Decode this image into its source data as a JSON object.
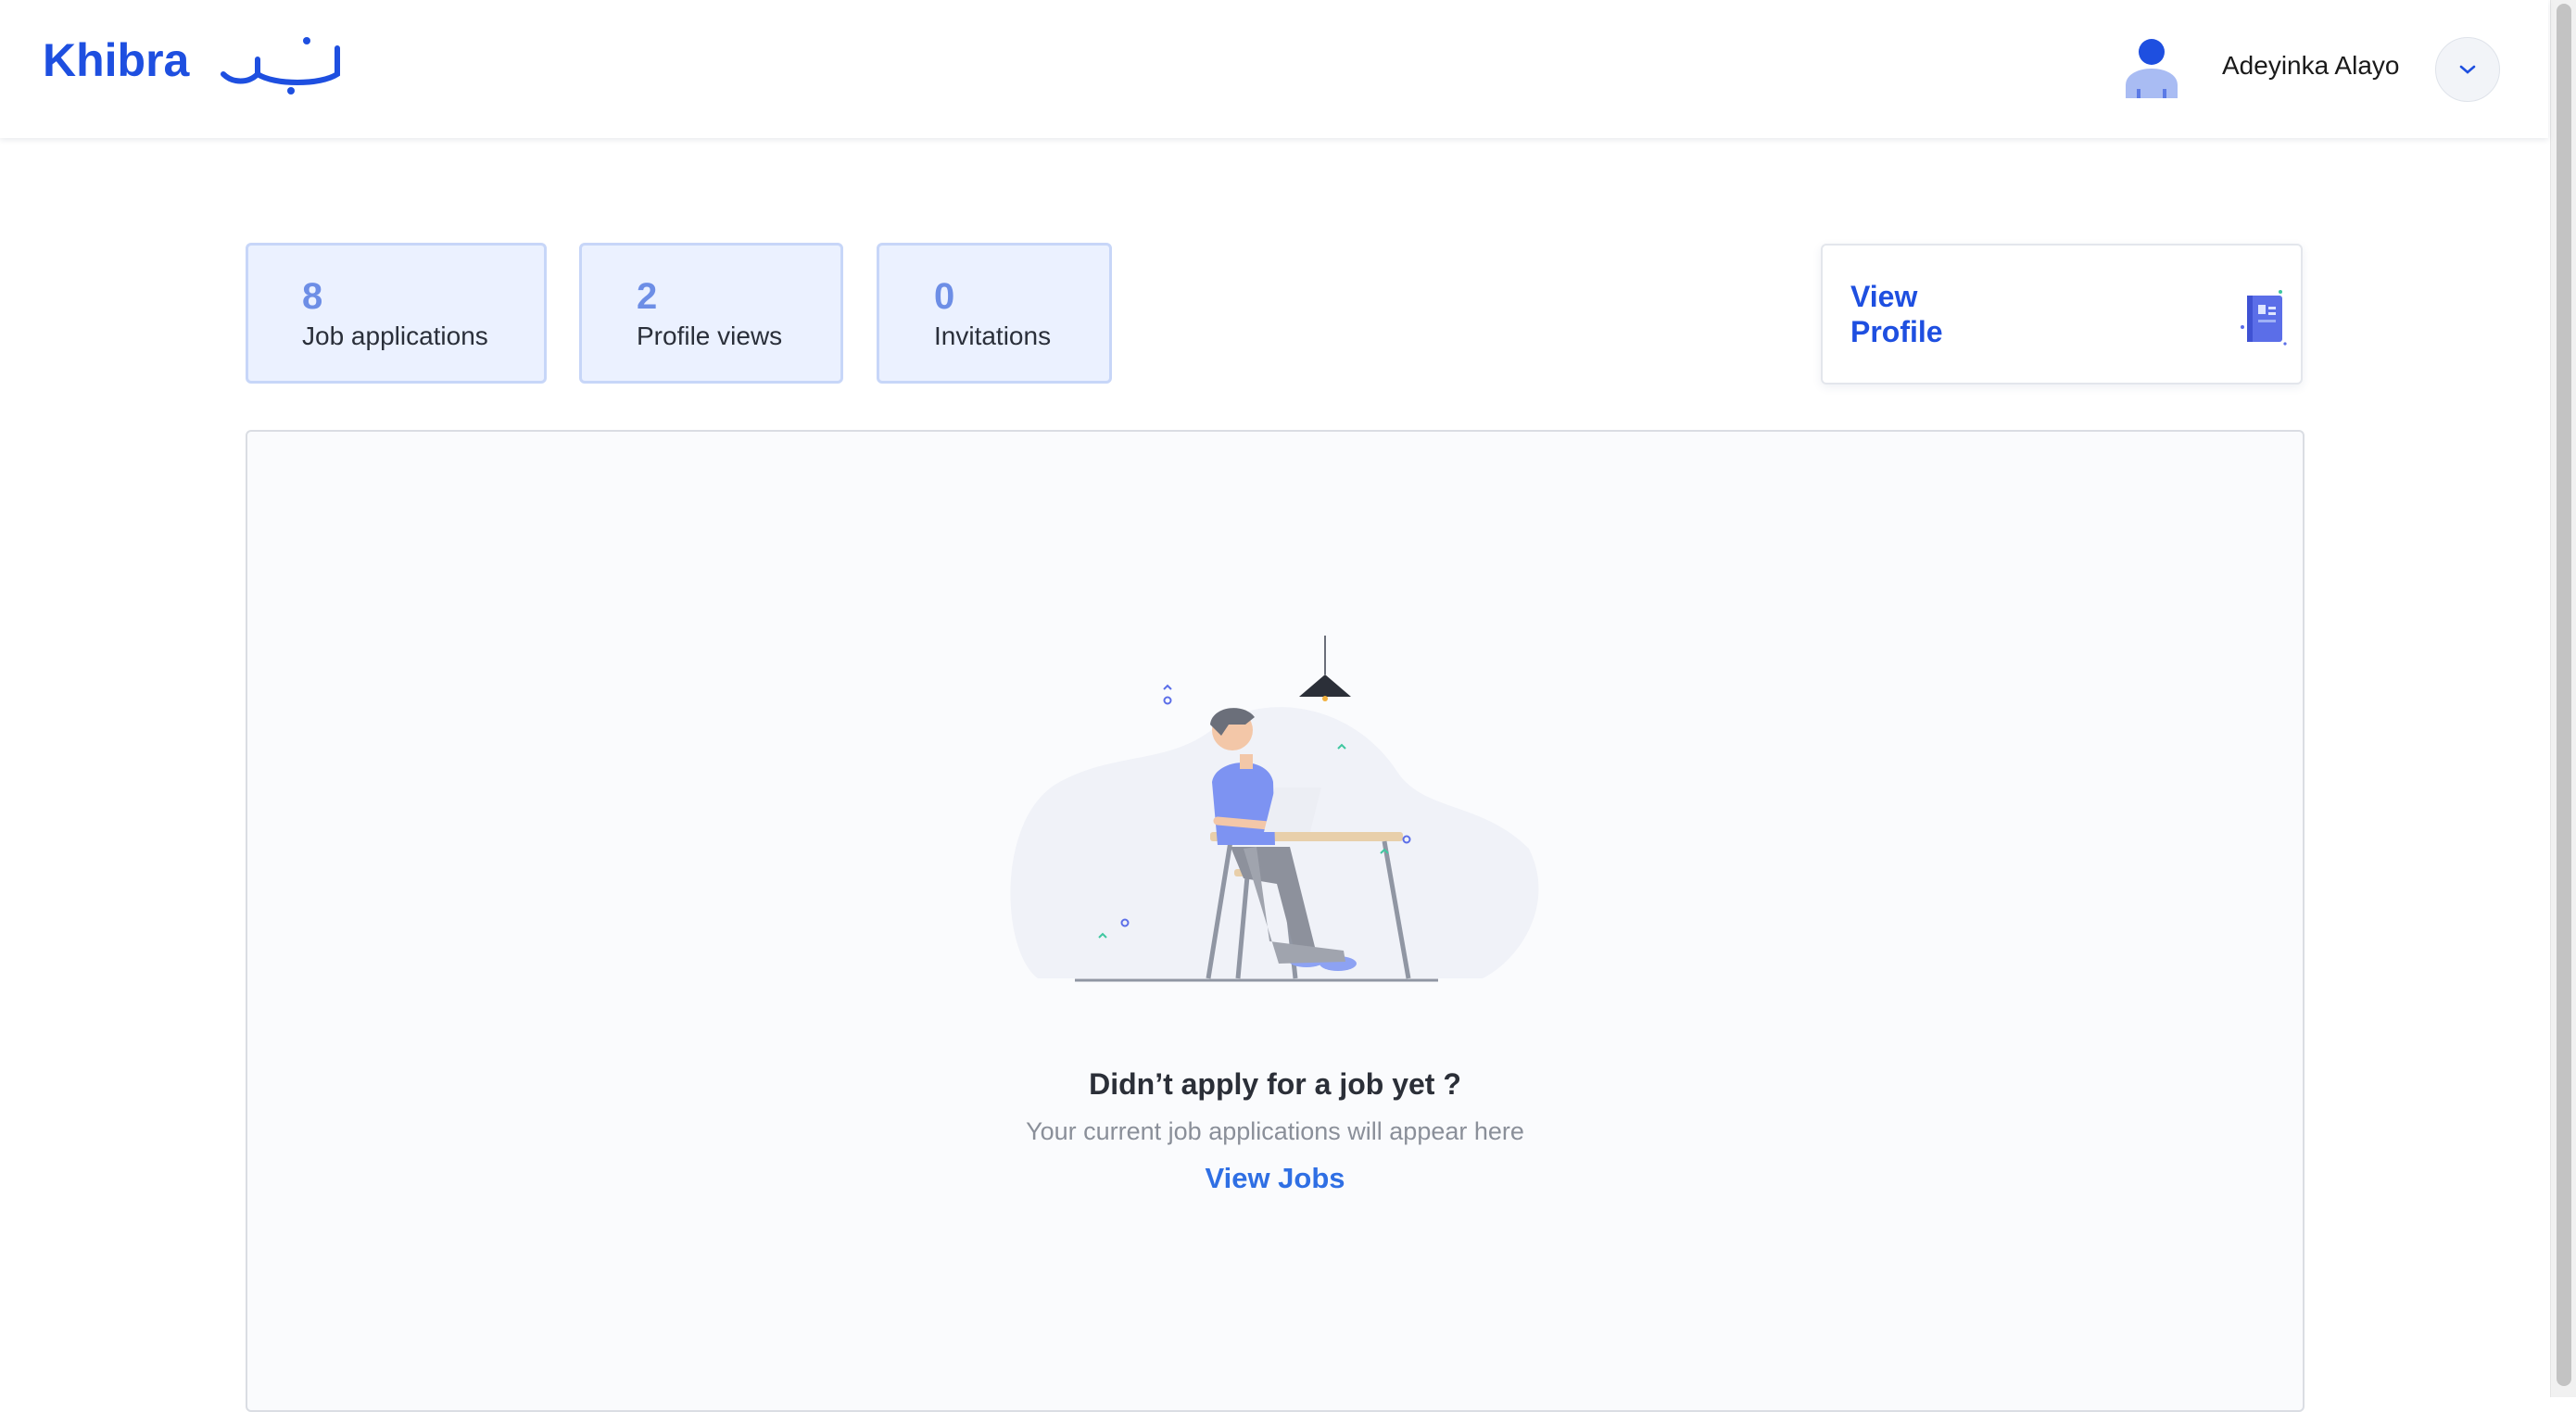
{
  "header": {
    "logo_text": "Khibra",
    "user_name": "Adeyinka Alayo"
  },
  "stats": [
    {
      "value": "8",
      "label": "Job applications"
    },
    {
      "value": "2",
      "label": "Profile views"
    },
    {
      "value": "0",
      "label": "Invitations"
    }
  ],
  "profile_card": {
    "label": "View Profile"
  },
  "empty_state": {
    "title": "Didn’t apply for a job yet ?",
    "subtitle": "Your current job applications will appear here",
    "link_label": "View Jobs"
  },
  "colors": {
    "brand": "#1e4fe0",
    "stat_bg": "#ebf1ff",
    "stat_number": "#6d8ee6",
    "link": "#2f6fe4"
  },
  "icons": [
    "user-avatar-icon",
    "chevron-down-icon",
    "profile-document-icon",
    "desk-illustration"
  ]
}
